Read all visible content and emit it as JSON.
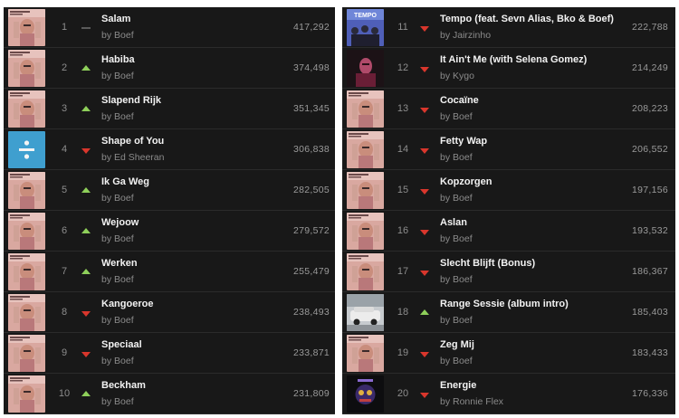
{
  "colors": {
    "background": "#181818",
    "row_divider": "#2b2b2b",
    "trend_up": "#8ecf5a",
    "trend_down": "#d9362c",
    "trend_same": "#5a5a5a",
    "title_text": "#f2f2f2",
    "secondary_text": "#8b8b8b"
  },
  "left_list": [
    {
      "rank": "1",
      "title": "Salam",
      "artist": "by Boef",
      "streams": "417,292",
      "trend": "same",
      "art": "boef-album-art"
    },
    {
      "rank": "2",
      "title": "Habiba",
      "artist": "by Boef",
      "streams": "374,498",
      "trend": "up",
      "art": "boef-album-art"
    },
    {
      "rank": "3",
      "title": "Slapend Rijk",
      "artist": "by Boef",
      "streams": "351,345",
      "trend": "up",
      "art": "boef-album-art"
    },
    {
      "rank": "4",
      "title": "Shape of You",
      "artist": "by Ed Sheeran",
      "streams": "306,838",
      "trend": "down",
      "art": "divide-album-art"
    },
    {
      "rank": "5",
      "title": "Ik Ga Weg",
      "artist": "by Boef",
      "streams": "282,505",
      "trend": "up",
      "art": "boef-album-art"
    },
    {
      "rank": "6",
      "title": "Wejoow",
      "artist": "by Boef",
      "streams": "279,572",
      "trend": "up",
      "art": "boef-album-art"
    },
    {
      "rank": "7",
      "title": "Werken",
      "artist": "by Boef",
      "streams": "255,479",
      "trend": "up",
      "art": "boef-album-art"
    },
    {
      "rank": "8",
      "title": "Kangoeroe",
      "artist": "by Boef",
      "streams": "238,493",
      "trend": "down",
      "art": "boef-album-art"
    },
    {
      "rank": "9",
      "title": "Speciaal",
      "artist": "by Boef",
      "streams": "233,871",
      "trend": "down",
      "art": "boef-album-art"
    },
    {
      "rank": "10",
      "title": "Beckham",
      "artist": "by Boef",
      "streams": "231,809",
      "trend": "up",
      "art": "boef-album-art"
    }
  ],
  "right_list": [
    {
      "rank": "11",
      "title": "Tempo (feat. Sevn Alias, Bko & Boef)",
      "artist": "by Jairzinho",
      "streams": "222,788",
      "trend": "down",
      "art": "tempo-album-art",
      "art_text": "TEMPO"
    },
    {
      "rank": "12",
      "title": "It Ain't Me (with Selena Gomez)",
      "artist": "by Kygo",
      "streams": "214,249",
      "trend": "down",
      "art": "kygo-album-art"
    },
    {
      "rank": "13",
      "title": "Cocaïne",
      "artist": "by Boef",
      "streams": "208,223",
      "trend": "down",
      "art": "boef-album-art"
    },
    {
      "rank": "14",
      "title": "Fetty Wap",
      "artist": "by Boef",
      "streams": "206,552",
      "trend": "down",
      "art": "boef-album-art"
    },
    {
      "rank": "15",
      "title": "Kopzorgen",
      "artist": "by Boef",
      "streams": "197,156",
      "trend": "down",
      "art": "boef-album-art"
    },
    {
      "rank": "16",
      "title": "Aslan",
      "artist": "by Boef",
      "streams": "193,532",
      "trend": "down",
      "art": "boef-album-art"
    },
    {
      "rank": "17",
      "title": "Slecht Blijft (Bonus)",
      "artist": "by Boef",
      "streams": "186,367",
      "trend": "down",
      "art": "boef-album-art"
    },
    {
      "rank": "18",
      "title": "Range Sessie (album intro)",
      "artist": "by Boef",
      "streams": "185,403",
      "trend": "up",
      "art": "range-sessie-album-art"
    },
    {
      "rank": "19",
      "title": "Zeg Mij",
      "artist": "by Boef",
      "streams": "183,433",
      "trend": "down",
      "art": "boef-album-art"
    },
    {
      "rank": "20",
      "title": "Energie",
      "artist": "by Ronnie Flex",
      "streams": "176,336",
      "trend": "down",
      "art": "ronnie-flex-album-art"
    }
  ]
}
